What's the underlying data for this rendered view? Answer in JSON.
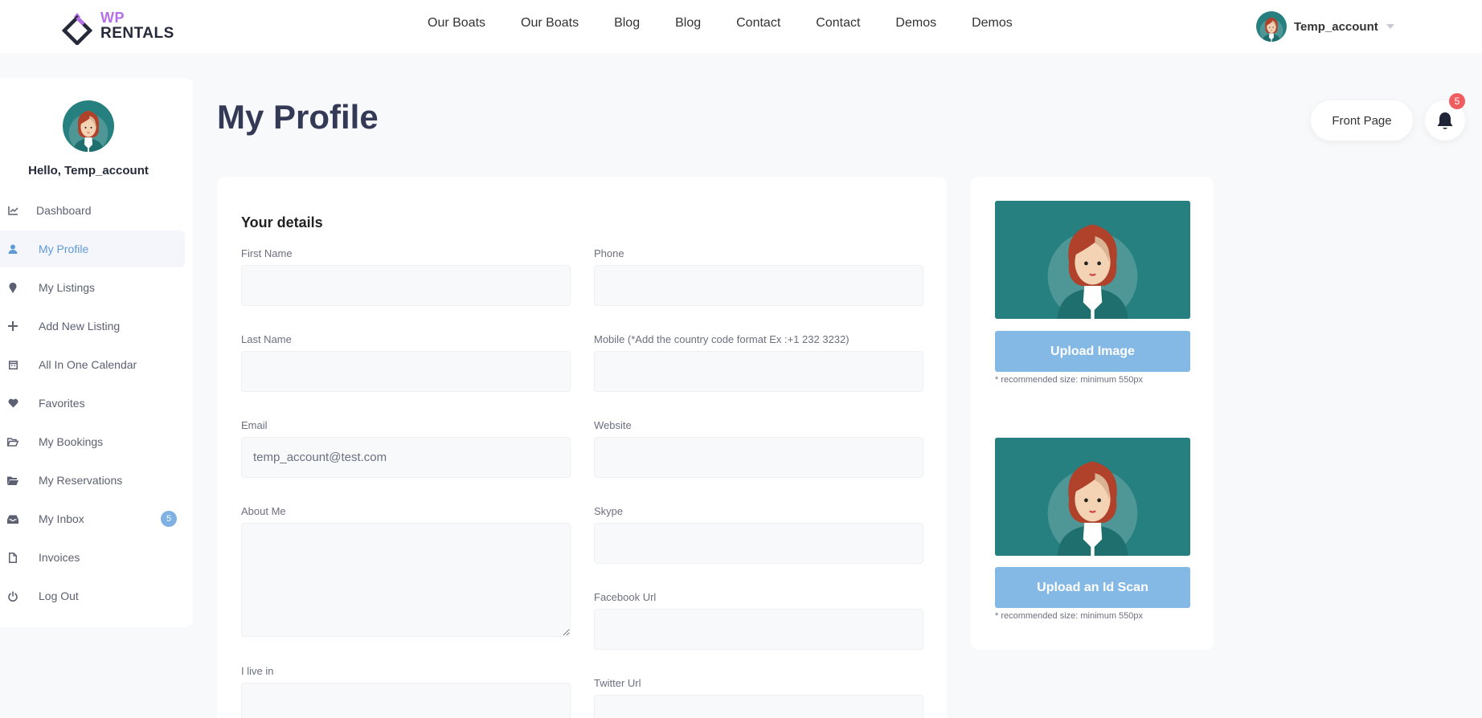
{
  "logo": {
    "wp": "WP",
    "rentals": "RENTALS",
    "brand_color": "#b56fe9"
  },
  "nav": {
    "items": [
      "Our Boats",
      "Our Boats",
      "Blog",
      "Blog",
      "Contact",
      "Contact",
      "Demos",
      "Demos"
    ]
  },
  "user_menu": {
    "username": "Temp_account",
    "icon": "chevron-down-icon"
  },
  "sidebar": {
    "hello": "Hello, Temp_account",
    "items": [
      {
        "label": "Dashboard",
        "icon": "chart-icon"
      },
      {
        "label": "My Profile",
        "icon": "user-icon",
        "active": true
      },
      {
        "label": "My Listings",
        "icon": "map-pin-icon"
      },
      {
        "label": "Add New Listing",
        "icon": "plus-icon"
      },
      {
        "label": "All In One Calendar",
        "icon": "calendar-icon"
      },
      {
        "label": "Favorites",
        "icon": "heart-icon"
      },
      {
        "label": "My Bookings",
        "icon": "folder-open-icon"
      },
      {
        "label": "My Reservations",
        "icon": "folder-icon"
      },
      {
        "label": "My Inbox",
        "icon": "inbox-icon",
        "badge": "5"
      },
      {
        "label": "Invoices",
        "icon": "file-icon"
      },
      {
        "label": "Log Out",
        "icon": "power-icon"
      }
    ],
    "active_color": "#5d9ad9",
    "badge_color": "#7fb1e3"
  },
  "main": {
    "title": "My Profile",
    "front_page_label": "Front Page",
    "notifications_count": "5",
    "notification_badge_color": "#f05d5e"
  },
  "details": {
    "title": "Your details",
    "first_name": {
      "label": "First Name",
      "value": ""
    },
    "last_name": {
      "label": "Last Name",
      "value": ""
    },
    "email": {
      "label": "Email",
      "value": "temp_account@test.com"
    },
    "about": {
      "label": "About Me",
      "value": ""
    },
    "live_in": {
      "label": "I live in",
      "value": ""
    },
    "phone": {
      "label": "Phone",
      "value": ""
    },
    "mobile": {
      "label": "Mobile (*Add the country code format Ex :+1 232 3232)",
      "value": ""
    },
    "website": {
      "label": "Website",
      "value": ""
    },
    "skype": {
      "label": "Skype",
      "value": ""
    },
    "facebook": {
      "label": "Facebook Url",
      "value": ""
    },
    "twitter": {
      "label": "Twitter Url",
      "value": ""
    }
  },
  "uploads": {
    "image_button": "Upload Image",
    "image_hint": "* recommended size: minimum 550px",
    "id_button": "Upload an Id Scan",
    "id_hint": "* recommended size: minimum 550px",
    "button_color": "#84b9e6",
    "photo_bg_color": "#26807f"
  }
}
